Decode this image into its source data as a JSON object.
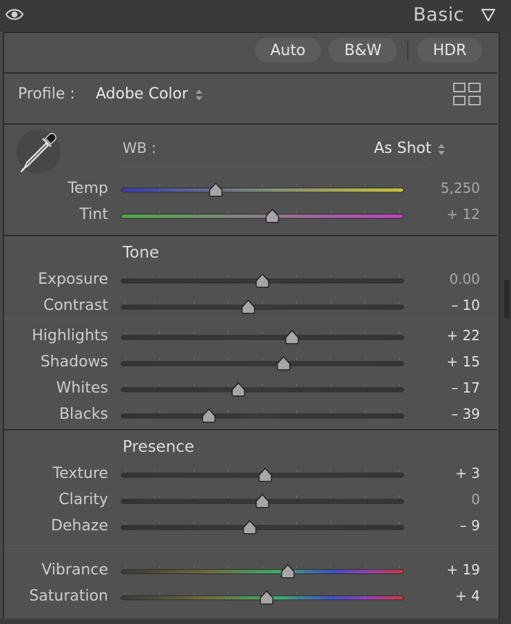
{
  "panel": {
    "title": "Basic",
    "icons": {
      "visibility": "eye-icon",
      "collapse": "triangle-down-icon"
    }
  },
  "buttons": {
    "auto": "Auto",
    "bw": "B&W",
    "hdr": "HDR"
  },
  "profile": {
    "label": "Profile :",
    "value": "Adobe Color"
  },
  "white_balance": {
    "label": "WB :",
    "value": "As Shot"
  },
  "groups": {
    "tone": "Tone",
    "presence": "Presence"
  },
  "sliders": {
    "temp": {
      "label": "Temp",
      "value": "5,250",
      "position": 0.335,
      "track": "temp"
    },
    "tint": {
      "label": "Tint",
      "value": "+ 12",
      "position": 0.535,
      "track": "tint"
    },
    "exposure": {
      "label": "Exposure",
      "value": "0.00",
      "position": 0.5,
      "track": "neutral"
    },
    "contrast": {
      "label": "Contrast",
      "value": "– 10",
      "position": 0.45,
      "track": "neutral"
    },
    "highlights": {
      "label": "Highlights",
      "value": "+ 22",
      "position": 0.605,
      "track": "neutral"
    },
    "shadows": {
      "label": "Shadows",
      "value": "+ 15",
      "position": 0.575,
      "track": "neutral"
    },
    "whites": {
      "label": "Whites",
      "value": "– 17",
      "position": 0.415,
      "track": "neutral"
    },
    "blacks": {
      "label": "Blacks",
      "value": "– 39",
      "position": 0.31,
      "track": "neutral"
    },
    "texture": {
      "label": "Texture",
      "value": "+ 3",
      "position": 0.51,
      "track": "neutral"
    },
    "clarity": {
      "label": "Clarity",
      "value": "0",
      "position": 0.5,
      "track": "neutral"
    },
    "dehaze": {
      "label": "Dehaze",
      "value": "– 9",
      "position": 0.455,
      "track": "neutral"
    },
    "vibrance": {
      "label": "Vibrance",
      "value": "+ 19",
      "position": 0.59,
      "track": "color"
    },
    "saturation": {
      "label": "Saturation",
      "value": "+ 4",
      "position": 0.515,
      "track": "color"
    }
  },
  "colors": {
    "panel_bg": "#515151",
    "header_bg": "#3a3a3a",
    "divider": "#2c2c2c",
    "button_bg": "#5c5c5c",
    "thumb": "#a6a6a6"
  }
}
